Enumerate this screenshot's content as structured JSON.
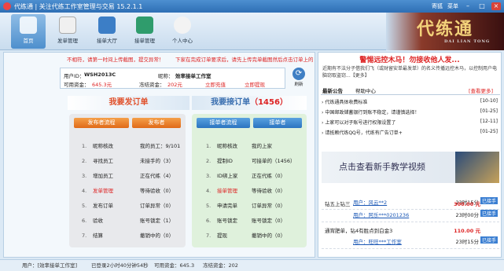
{
  "title": "代练通 | 关注代练工作室管理与交易 15.2.1.1",
  "window": {
    "user_name": "寄狐",
    "menu": "菜单"
  },
  "toolbar": [
    {
      "label": "首页"
    },
    {
      "label": "发单管理"
    },
    {
      "label": "接单大厅"
    },
    {
      "label": "接单管理"
    },
    {
      "label": "个人中心"
    }
  ],
  "brand": {
    "title": "代练通",
    "subtitle": "DAI LIAN TONG"
  },
  "notices": {
    "left": "不相符，请第一时间上传截图，提交异常！",
    "right": "下家在完成订单要求后，请先上传完单截图然后点击订单上的"
  },
  "user": {
    "id_label": "用户ID：",
    "id_value": "WSH2013C",
    "nick_label": "昵称：",
    "nick_value": "效率接单工作室",
    "avail_label": "可用资金：",
    "avail_value": "645.3元",
    "frozen_label": "冻结资金：",
    "frozen_value": "202元",
    "recharge": "立即充值",
    "withdraw": "立即提现",
    "refresh": "刷新"
  },
  "sections": {
    "post": "我要发订单",
    "take": "我要接订单",
    "take_count": "（1456）"
  },
  "left_panel": {
    "flow_btn": "发布者流程",
    "role_btn": "发布者",
    "steps": [
      "昵称核改",
      "寻找员工",
      "增加员工",
      "发单管理",
      "发布订单",
      "验收",
      "结算"
    ],
    "labels": [
      "我的员工：9/101",
      "未接手的（3）",
      "正在代练（4）",
      "等待验收（0）",
      "订单异常（0）",
      "账号锁定（1）",
      "撤销中的（0）"
    ]
  },
  "right_panel": {
    "flow_btn": "接单者流程",
    "role_btn": "接单者",
    "steps": [
      "昵称核改",
      "提制ID",
      "ID绑上家",
      "接单管理",
      "申请完单",
      "账号锁定",
      "提现"
    ],
    "labels": [
      "我的上家",
      "可接单的（1456）",
      "正在代练（0）",
      "等待验收（0）",
      "订单异常（0）",
      "账号锁定（0）",
      "撤销中的（0）"
    ]
  },
  "side": {
    "ad_title": "警惕远控木马！勿接收他人发...",
    "ad_text": "近期有不法分子借我们飞（或财留安单最发单）的名义传播远控木马，以控制用户电脑窃取盗窃...【更多】",
    "tab1": "最新公告",
    "tab2": "帮助中心",
    "tab_more": "[查看更多]",
    "news": [
      {
        "t": "代练通具体收费标准",
        "d": "[10-10]"
      },
      {
        "t": "中国邮政储蓄银行到账不稳定，请谨慎选择！",
        "d": "[01-25]"
      },
      {
        "t": "上家可以对子账号进行权限设置了",
        "d": "[12-11]"
      },
      {
        "t": "请抵赖代练QQ号，代练有广告订单+",
        "d": "[01-25]"
      }
    ],
    "banner": "点击查看新手教学视频",
    "orders": [
      {
        "t": "",
        "p": "",
        "u": "用户：风云**2",
        "tm": "23时15分",
        "take": "已接手"
      },
      {
        "t": "钻五上钻三",
        "p": "300.00 元",
        "u": "用户：阿乐***0201236",
        "tm": "23时00分",
        "take": "已接手"
      },
      {
        "t": "通宵肥单，钻4有胜点到白金3",
        "p": "110.00 元",
        "u": "用户：旺旺***工作室",
        "tm": "23时15分",
        "take": "已接手"
      }
    ]
  },
  "status": {
    "user": "用户：[效率接单工作室]",
    "online": "已登录2小时40分钟54秒",
    "avail": "可用资金：645.3",
    "frozen": "冻结资金：202"
  }
}
